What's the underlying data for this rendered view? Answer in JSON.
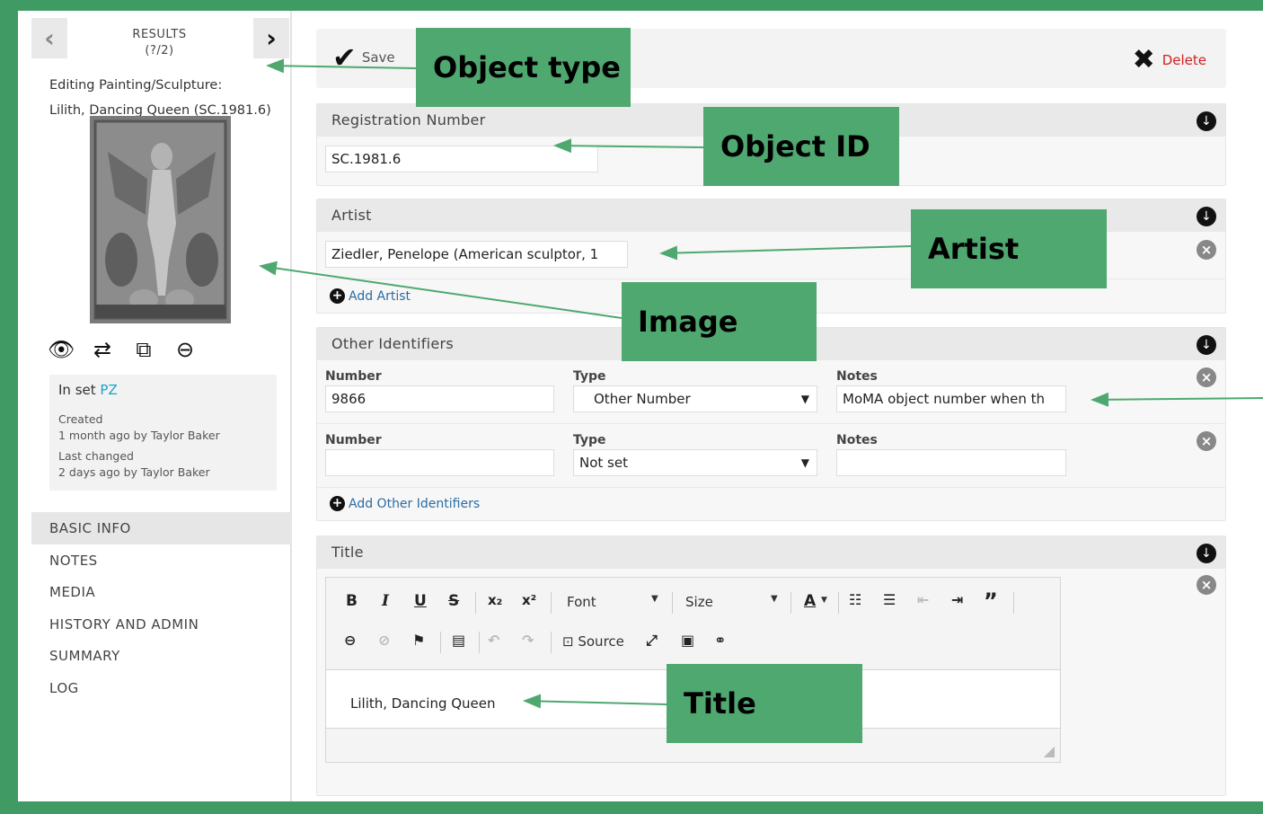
{
  "sidebar": {
    "results_title": "RESULTS",
    "results_count": "(?/2)",
    "editing_label": "Editing Painting/Sculpture:",
    "object_caption": "Lilith, Dancing Queen (SC.1981.6)",
    "image_actions": [
      {
        "icon": "eye-icon",
        "glyph": "👁"
      },
      {
        "icon": "retweet-icon",
        "glyph": "⇄"
      },
      {
        "icon": "copy-icon",
        "glyph": "⧉"
      },
      {
        "icon": "remove-icon",
        "glyph": "⊖"
      }
    ],
    "in_set_prefix": "In set",
    "in_set_name": "PZ",
    "created_label": "Created",
    "created_value": "1 month ago by Taylor Baker",
    "changed_label": "Last changed",
    "changed_value": "2 days ago by Taylor Baker",
    "nav": [
      {
        "label": "BASIC INFO",
        "active": true
      },
      {
        "label": "NOTES"
      },
      {
        "label": "MEDIA"
      },
      {
        "label": "HISTORY AND ADMIN"
      },
      {
        "label": "SUMMARY"
      },
      {
        "label": "LOG"
      }
    ]
  },
  "toolbar": {
    "save_label": "Save",
    "delete_label": "Delete"
  },
  "registration": {
    "header": "Registration Number",
    "value": "SC.1981.6"
  },
  "artist": {
    "header": "Artist",
    "value": "Ziedler, Penelope (American sculptor, 1",
    "add_label": "Add Artist"
  },
  "other_identifiers": {
    "header": "Other Identifiers",
    "rows": [
      {
        "number_label": "Number",
        "number": "9866",
        "type_label": "Type",
        "type": "Other Number",
        "notes_label": "Notes",
        "notes": "MoMA object number when th"
      },
      {
        "number_label": "Number",
        "number": "",
        "type_label": "Type",
        "type": "Not set",
        "notes_label": "Notes",
        "notes": ""
      }
    ],
    "add_label": "Add Other Identifiers"
  },
  "title_section": {
    "header": "Title",
    "toolbar": {
      "font_label": "Font",
      "size_label": "Size",
      "source_label": "Source"
    },
    "content": "Lilith, Dancing Queen"
  },
  "annotations": {
    "object_type": "Object type",
    "object_id": "Object ID",
    "artist": "Artist",
    "image": "Image",
    "title": "Title"
  },
  "colors": {
    "background": "#3f9a63",
    "callout": "#4ea86f",
    "link": "#2b6ca3",
    "set_link": "#1aa3c9",
    "delete": "#d02020"
  }
}
